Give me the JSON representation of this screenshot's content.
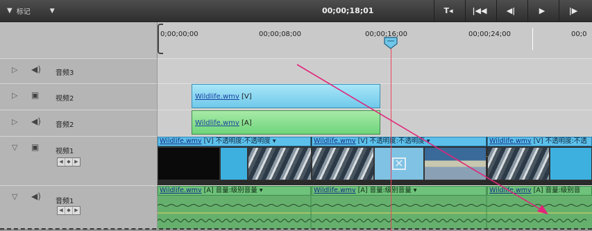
{
  "toolbar": {
    "marker_label": "标记",
    "timecode": "00;00;18;01"
  },
  "ruler": {
    "ticks": [
      "0;00;00;00",
      "00;00;08;00",
      "00;00;16;00",
      "00;00;24;00",
      "00;0"
    ]
  },
  "tracks": {
    "audio3": {
      "name": "音频3"
    },
    "video2": {
      "name": "视频2"
    },
    "audio2": {
      "name": "音频2"
    },
    "video1": {
      "name": "视频1"
    },
    "audio1": {
      "name": "音频1"
    }
  },
  "clips": {
    "video2_clip": {
      "file": "Wildlife.wmv",
      "tag": " [V]"
    },
    "audio2_clip": {
      "file": "Wildlife.wmv",
      "tag": " [A]"
    },
    "video1_clips": [
      {
        "file": "Wildlife.wmv",
        "tag": " [V] 不透明度:不透明度 ▾"
      },
      {
        "file": "Wildlife.wmv",
        "tag": " [V] 不透明度:不透明度 ▾"
      },
      {
        "file": "Wildlife.wmv",
        "tag": " [V] 不透明度:不透"
      }
    ],
    "audio1_clips": [
      {
        "file": "Wildlife.wmv",
        "tag": " [A] 音量:级别音量 ▾"
      },
      {
        "file": "Wildlife.wmv",
        "tag": " [A] 音量:级别音量 ▾"
      },
      {
        "file": "Wildlife.wmv",
        "tag": " [A] 音量:级别音"
      }
    ]
  },
  "colors": {
    "accent_arrow": "#e0267a",
    "playhead": "#e8465a",
    "video_clip": "#5cc0ea",
    "audio_clip": "#6ec27a"
  }
}
